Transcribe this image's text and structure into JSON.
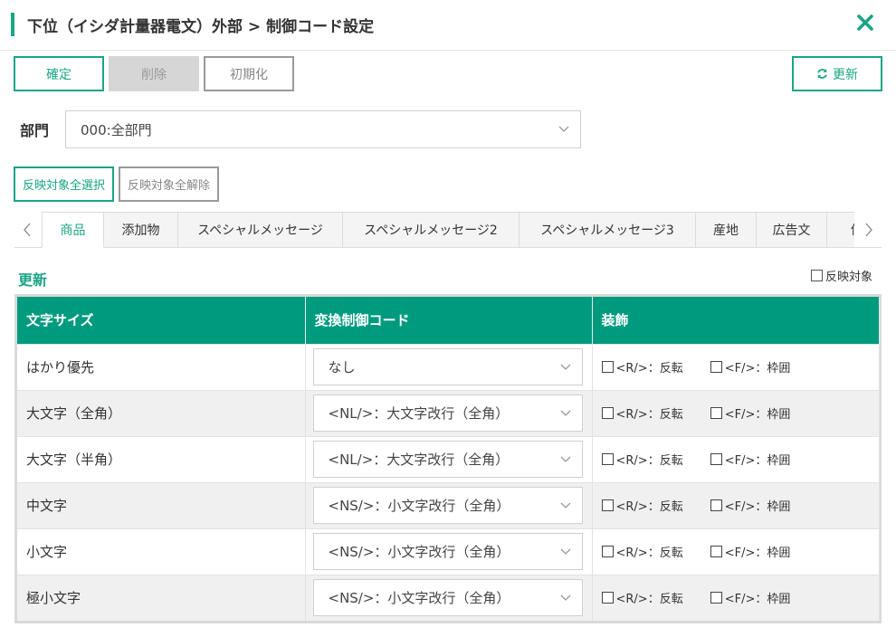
{
  "header": {
    "title": "下位（イシダ計量器電文）外部 > 制御コード設定"
  },
  "toolbar": {
    "confirm": "確定",
    "delete": "削除",
    "init": "初期化",
    "refresh": "更新"
  },
  "department": {
    "label": "部門",
    "value": "000:全部門"
  },
  "reflect": {
    "select_all": "反映対象全選択",
    "clear_all": "反映対象全解除"
  },
  "tabs": [
    {
      "label": "商品",
      "active": true
    },
    {
      "label": "添加物"
    },
    {
      "label": "スペシャルメッセージ"
    },
    {
      "label": "スペシャルメッセージ2"
    },
    {
      "label": "スペシャルメッセージ3"
    },
    {
      "label": "産地"
    },
    {
      "label": "広告文"
    },
    {
      "label": "価"
    }
  ],
  "section": {
    "title": "更新",
    "reflect_target": "反映対象"
  },
  "table": {
    "headers": [
      "文字サイズ",
      "変換制御コード",
      "装飾"
    ],
    "rows": [
      {
        "size": "はかり優先",
        "code": "なし",
        "r": "<R/>：反転",
        "f": "<F/>：枠囲"
      },
      {
        "size": "大文字（全角）",
        "code": "<NL/>：大文字改行（全角）",
        "r": "<R/>：反転",
        "f": "<F/>：枠囲"
      },
      {
        "size": "大文字（半角）",
        "code": "<NL/>：大文字改行（全角）",
        "r": "<R/>：反転",
        "f": "<F/>：枠囲"
      },
      {
        "size": "中文字",
        "code": "<NS/>：小文字改行（全角）",
        "r": "<R/>：反転",
        "f": "<F/>：枠囲"
      },
      {
        "size": "小文字",
        "code": "<NS/>：小文字改行（全角）",
        "r": "<R/>：反転",
        "f": "<F/>：枠囲"
      },
      {
        "size": "極小文字",
        "code": "<NS/>：小文字改行（全角）",
        "r": "<R/>：反転",
        "f": "<F/>：枠囲"
      }
    ]
  },
  "colors": {
    "accent": "#1aa486",
    "header_bg": "#009b7f",
    "disabled": "#d6d6d6"
  },
  "icons": {
    "close": "close-icon",
    "refresh": "refresh-icon",
    "chevron": "chevron-down-icon"
  }
}
